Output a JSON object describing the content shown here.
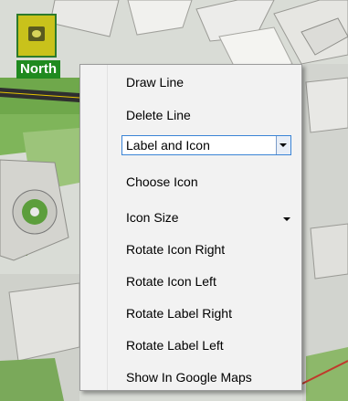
{
  "map": {
    "label": "North"
  },
  "menu": {
    "items": [
      {
        "label": "Draw Line"
      },
      {
        "label": "Delete Line"
      },
      {
        "label": "Choose Icon"
      },
      {
        "label": "Icon Size"
      },
      {
        "label": "Rotate Icon Right"
      },
      {
        "label": "Rotate Icon Left"
      },
      {
        "label": "Rotate Label Right"
      },
      {
        "label": "Rotate Label Left"
      },
      {
        "label": "Show In Google Maps"
      }
    ],
    "display_mode": {
      "selected": "Label and Icon"
    }
  },
  "colors": {
    "menu_bg": "#f2f2f2",
    "combo_border": "#3a84d6",
    "map_label_bg": "#1f8a1f"
  }
}
